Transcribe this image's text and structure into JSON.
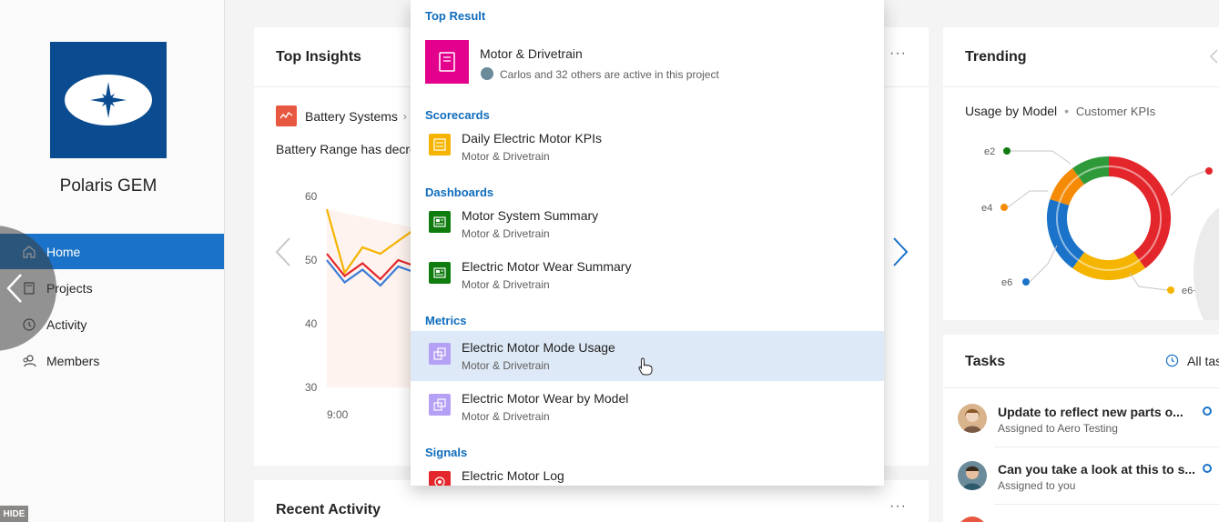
{
  "sidebar": {
    "brand": "Polaris GEM",
    "nav": [
      {
        "label": "Home",
        "icon": "home-icon"
      },
      {
        "label": "Projects",
        "icon": "projects-icon"
      },
      {
        "label": "Activity",
        "icon": "history-icon"
      },
      {
        "label": "Members",
        "icon": "members-icon"
      }
    ],
    "hide_label": "HIDE"
  },
  "insights": {
    "title": "Top Insights",
    "breadcrumb": "Battery Systems",
    "text": "Battery Range has decre",
    "chart_data": {
      "type": "line",
      "title": "",
      "xlabel": "",
      "ylabel": "",
      "y_ticks": [
        "60",
        "50",
        "40",
        "30"
      ],
      "x_ticks": [
        "9:00"
      ],
      "ylim": [
        28,
        62
      ],
      "x": [
        0,
        1,
        2,
        3,
        4,
        5
      ],
      "series": [
        {
          "color": "#f5b400",
          "values": [
            58,
            48,
            52,
            51,
            53,
            55
          ]
        },
        {
          "color": "#e3262b",
          "values": [
            51,
            47.5,
            49.5,
            47,
            50,
            49
          ]
        },
        {
          "color": "#3b7bd6",
          "values": [
            50,
            46.5,
            48.5,
            46,
            49,
            48
          ]
        }
      ]
    }
  },
  "recent": {
    "title": "Recent Activity"
  },
  "search": {
    "sections": [
      {
        "label": "Top Result",
        "items": [
          {
            "title": "Motor & Drivetrain",
            "subtitle": "Carlos and 32 others are active in this project",
            "icon": "notebook-icon",
            "color": "#e3008c"
          }
        ]
      },
      {
        "label": "Scorecards",
        "items": [
          {
            "title": "Daily Electric Motor KPIs",
            "subtitle": "Motor & Drivetrain",
            "icon": "scorecard-icon",
            "color": "#f5b400"
          }
        ]
      },
      {
        "label": "Dashboards",
        "items": [
          {
            "title": "Motor System Summary",
            "subtitle": "Motor & Drivetrain",
            "icon": "dashboard-icon",
            "color": "#107c10"
          },
          {
            "title": "Electric Motor Wear Summary",
            "subtitle": "Motor & Drivetrain",
            "icon": "dashboard-icon",
            "color": "#107c10"
          }
        ]
      },
      {
        "label": "Metrics",
        "items": [
          {
            "title": "Electric Motor Mode Usage",
            "subtitle": "Motor & Drivetrain",
            "icon": "metric-icon",
            "color": "#b4a0f5"
          },
          {
            "title": "Electric Motor Wear by Model",
            "subtitle": "Motor & Drivetrain",
            "icon": "metric-icon",
            "color": "#b4a0f5"
          }
        ]
      },
      {
        "label": "Signals",
        "items": [
          {
            "title": "Electric Motor Log",
            "subtitle": "",
            "icon": "signal-icon",
            "color": "#e3262b"
          }
        ]
      }
    ]
  },
  "trending": {
    "title": "Trending",
    "subtitle_main": "Usage by Model",
    "subtitle_secondary": "Customer KPIs",
    "chart_data": {
      "type": "pie",
      "labels": [
        "e2",
        "e4",
        "e6",
        "e6+"
      ],
      "slices": [
        {
          "color": "#e3262b",
          "value": 40
        },
        {
          "color": "#f5b400",
          "value": 20
        },
        {
          "color": "#1a73c8",
          "value": 20
        },
        {
          "color": "#f58a07",
          "value": 10
        },
        {
          "color": "#2e9a3a",
          "value": 10
        }
      ]
    }
  },
  "tasks": {
    "title": "Tasks",
    "filter": "All tas",
    "items": [
      {
        "title": "Update to reflect new parts o...",
        "subtitle": "Assigned to Aero Testing"
      },
      {
        "title": "Can you take a look at this to s...",
        "subtitle": "Assigned to you"
      }
    ]
  }
}
